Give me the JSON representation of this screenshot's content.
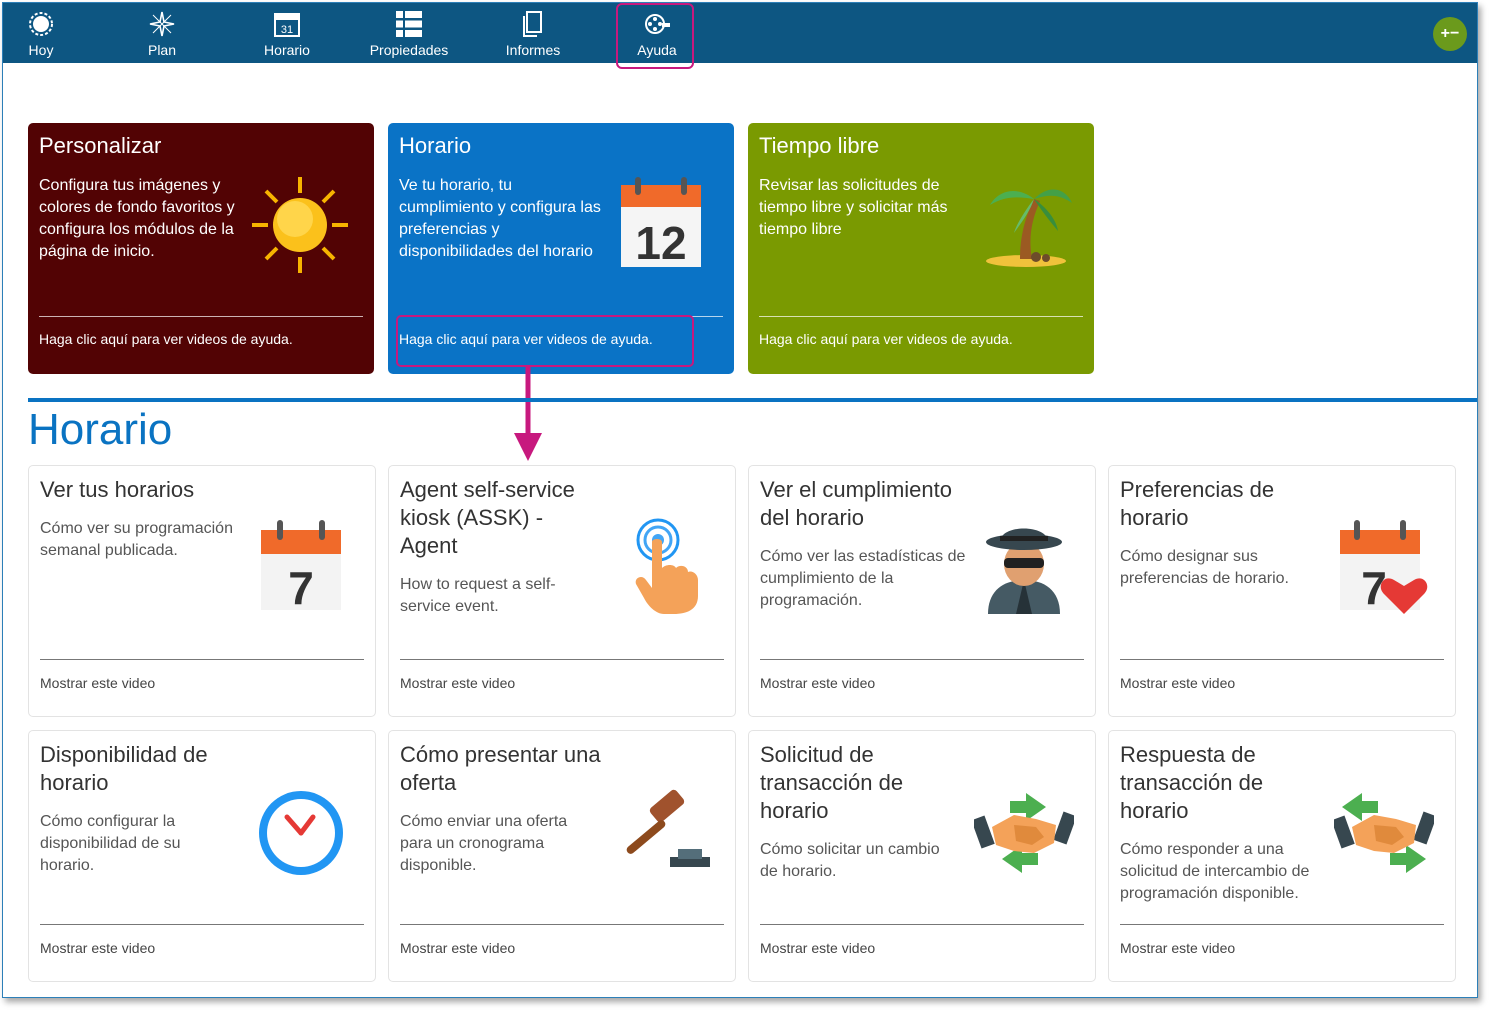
{
  "nav": {
    "items": [
      {
        "label": "Hoy",
        "icon": "sun-icon"
      },
      {
        "label": "Plan",
        "icon": "compass-icon"
      },
      {
        "label": "Horario",
        "icon": "calendar-icon"
      },
      {
        "label": "Propiedades",
        "icon": "list-icon"
      },
      {
        "label": "Informes",
        "icon": "document-icon"
      },
      {
        "label": "Ayuda",
        "icon": "film-reel-icon"
      }
    ],
    "active": "Ayuda",
    "zoom_label": "+−"
  },
  "tiles": [
    {
      "title": "Personalizar",
      "desc": "Configura tus imágenes y colores de fondo favoritos y configura los módulos de la página de inicio.",
      "link": "Haga clic aquí para ver videos de ayuda.",
      "color": "#520304",
      "icon": "sun-icon"
    },
    {
      "title": "Horario",
      "desc": "Ve tu horario, tu cumplimiento y configura las preferencias y disponibilidades del horario",
      "link": "Haga clic aquí para ver videos de ayuda.",
      "color": "#0a73c6",
      "icon": "calendar-icon",
      "icon_text": "12"
    },
    {
      "title": "Tiempo libre",
      "desc": "Revisar las solicitudes de tiempo libre y solicitar más tiempo libre",
      "link": "Haga clic aquí para ver videos de ayuda.",
      "color": "#7a9a01",
      "icon": "palm-tree-icon"
    }
  ],
  "section": {
    "title": "Horario"
  },
  "cards": [
    {
      "title": "Ver tus horarios",
      "desc": "Cómo ver su programación semanal publicada.",
      "link": "Mostrar este video",
      "icon": "calendar-icon",
      "icon_text": "7"
    },
    {
      "title": "Agent self-service kiosk (ASSK) - Agent",
      "desc": "How to request a self-service event.",
      "link": "Mostrar este video",
      "icon": "touch-hand-icon"
    },
    {
      "title": "Ver el cumplimiento del horario",
      "desc": "Cómo ver las estadísticas de cumplimiento de la programación.",
      "link": "Mostrar este video",
      "icon": "spy-icon"
    },
    {
      "title": "Preferencias de horario",
      "desc": "Cómo designar sus preferencias de horario.",
      "link": "Mostrar este video",
      "icon": "calendar-heart-icon",
      "icon_text": "7"
    },
    {
      "title": "Disponibilidad de horario",
      "desc": "Cómo configurar la disponibilidad de su horario.",
      "link": "Mostrar este video",
      "icon": "clock-icon"
    },
    {
      "title": "Cómo presentar una oferta",
      "desc": "Cómo enviar una oferta para un cronograma disponible.",
      "link": "Mostrar este video",
      "icon": "gavel-icon"
    },
    {
      "title": "Solicitud de transacción de horario",
      "desc": "Cómo solicitar un cambio de horario.",
      "link": "Mostrar este video",
      "icon": "handshake-swap-icon"
    },
    {
      "title": "Respuesta de transacción de horario",
      "desc": "Cómo responder a una solicitud de intercambio de programación disponible.",
      "link": "Mostrar este video",
      "icon": "handshake-swap-icon"
    }
  ],
  "colors": {
    "nav_bg": "#0d5682",
    "accent": "#0a73c2",
    "highlight": "#c7197e"
  }
}
